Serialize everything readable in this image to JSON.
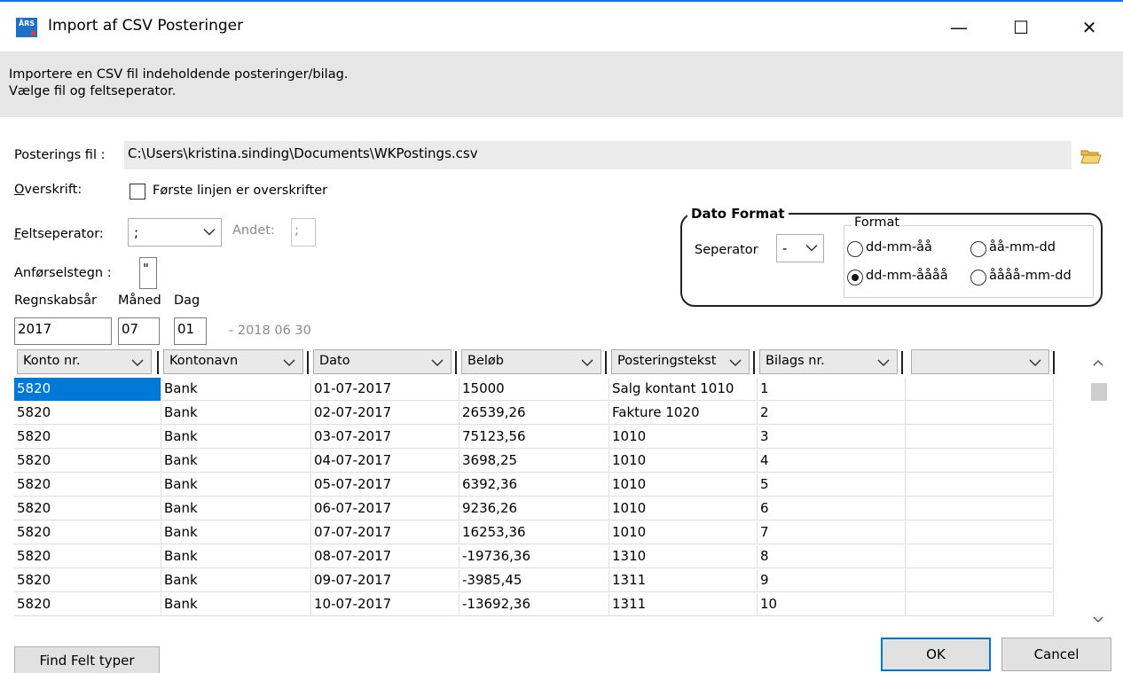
{
  "window": {
    "title": "Import af CSV Posteringer",
    "app_icon_text": "ÅRS",
    "minimize_label": "—",
    "maximize_label": "☐",
    "close_label": "✕"
  },
  "header": {
    "line1": "Importere en CSV fil indeholdende posteringer/bilag.",
    "line2": "Vælge fil og feltseperator."
  },
  "file": {
    "label": "Posterings fil :",
    "path": "C:\\Users\\kristina.sinding\\Documents\\WKPostings.csv"
  },
  "overskrift": {
    "label_first": "O",
    "label_rest": "verskrift:",
    "checkbox_label": "Første linjen er overskrifter",
    "checked": false
  },
  "feltseperator": {
    "label_first": "F",
    "label_rest": "eltseperator:",
    "value": ";",
    "andet_label": "Andet:",
    "andet_value": ";"
  },
  "anfoerselstegn": {
    "label": "Anførselstegn :",
    "value": "\""
  },
  "period": {
    "year_label": "Regnskabsår",
    "month_label": "Måned",
    "day_label": "Dag",
    "year": "2017",
    "month": "07",
    "day": "01",
    "end_text": "- 2018 06 30"
  },
  "dato_format": {
    "title": "Dato Format",
    "seperator_label": "Seperator",
    "seperator_value": "-",
    "format_title": "Format",
    "options": [
      {
        "label": "dd-mm-åå",
        "selected": false
      },
      {
        "label": "åå-mm-dd",
        "selected": false
      },
      {
        "label": "dd-mm-åååå",
        "selected": true
      },
      {
        "label": "åååå-mm-dd",
        "selected": false
      }
    ]
  },
  "grid": {
    "columns": [
      "Konto nr.",
      "Kontonavn",
      "Dato",
      "Beløb",
      "Posteringstekst",
      "Bilags nr.",
      ""
    ],
    "rows": [
      [
        "5820",
        "Bank",
        "01-07-2017",
        "15000",
        "Salg kontant 1010",
        "1",
        ""
      ],
      [
        "5820",
        "Bank",
        "02-07-2017",
        "26539,26",
        "Fakture 1020",
        "2",
        ""
      ],
      [
        "5820",
        "Bank",
        "03-07-2017",
        "75123,56",
        "1010",
        "3",
        ""
      ],
      [
        "5820",
        "Bank",
        "04-07-2017",
        "3698,25",
        "1010",
        "4",
        ""
      ],
      [
        "5820",
        "Bank",
        "05-07-2017",
        "6392,36",
        "1010",
        "5",
        ""
      ],
      [
        "5820",
        "Bank",
        "06-07-2017",
        "9236,26",
        "1010",
        "6",
        ""
      ],
      [
        "5820",
        "Bank",
        "07-07-2017",
        "16253,36",
        "1010",
        "7",
        ""
      ],
      [
        "5820",
        "Bank",
        "08-07-2017",
        "-19736,36",
        "1310",
        "8",
        ""
      ],
      [
        "5820",
        "Bank",
        "09-07-2017",
        "-3985,45",
        "1311",
        "9",
        ""
      ],
      [
        "5820",
        "Bank",
        "10-07-2017",
        "-13692,36",
        "1311",
        "10",
        ""
      ]
    ]
  },
  "scrollbar": {
    "up": "^",
    "down": "v"
  },
  "buttons": {
    "find": "Find Felt typer",
    "ok": "OK",
    "cancel": "Cancel"
  }
}
